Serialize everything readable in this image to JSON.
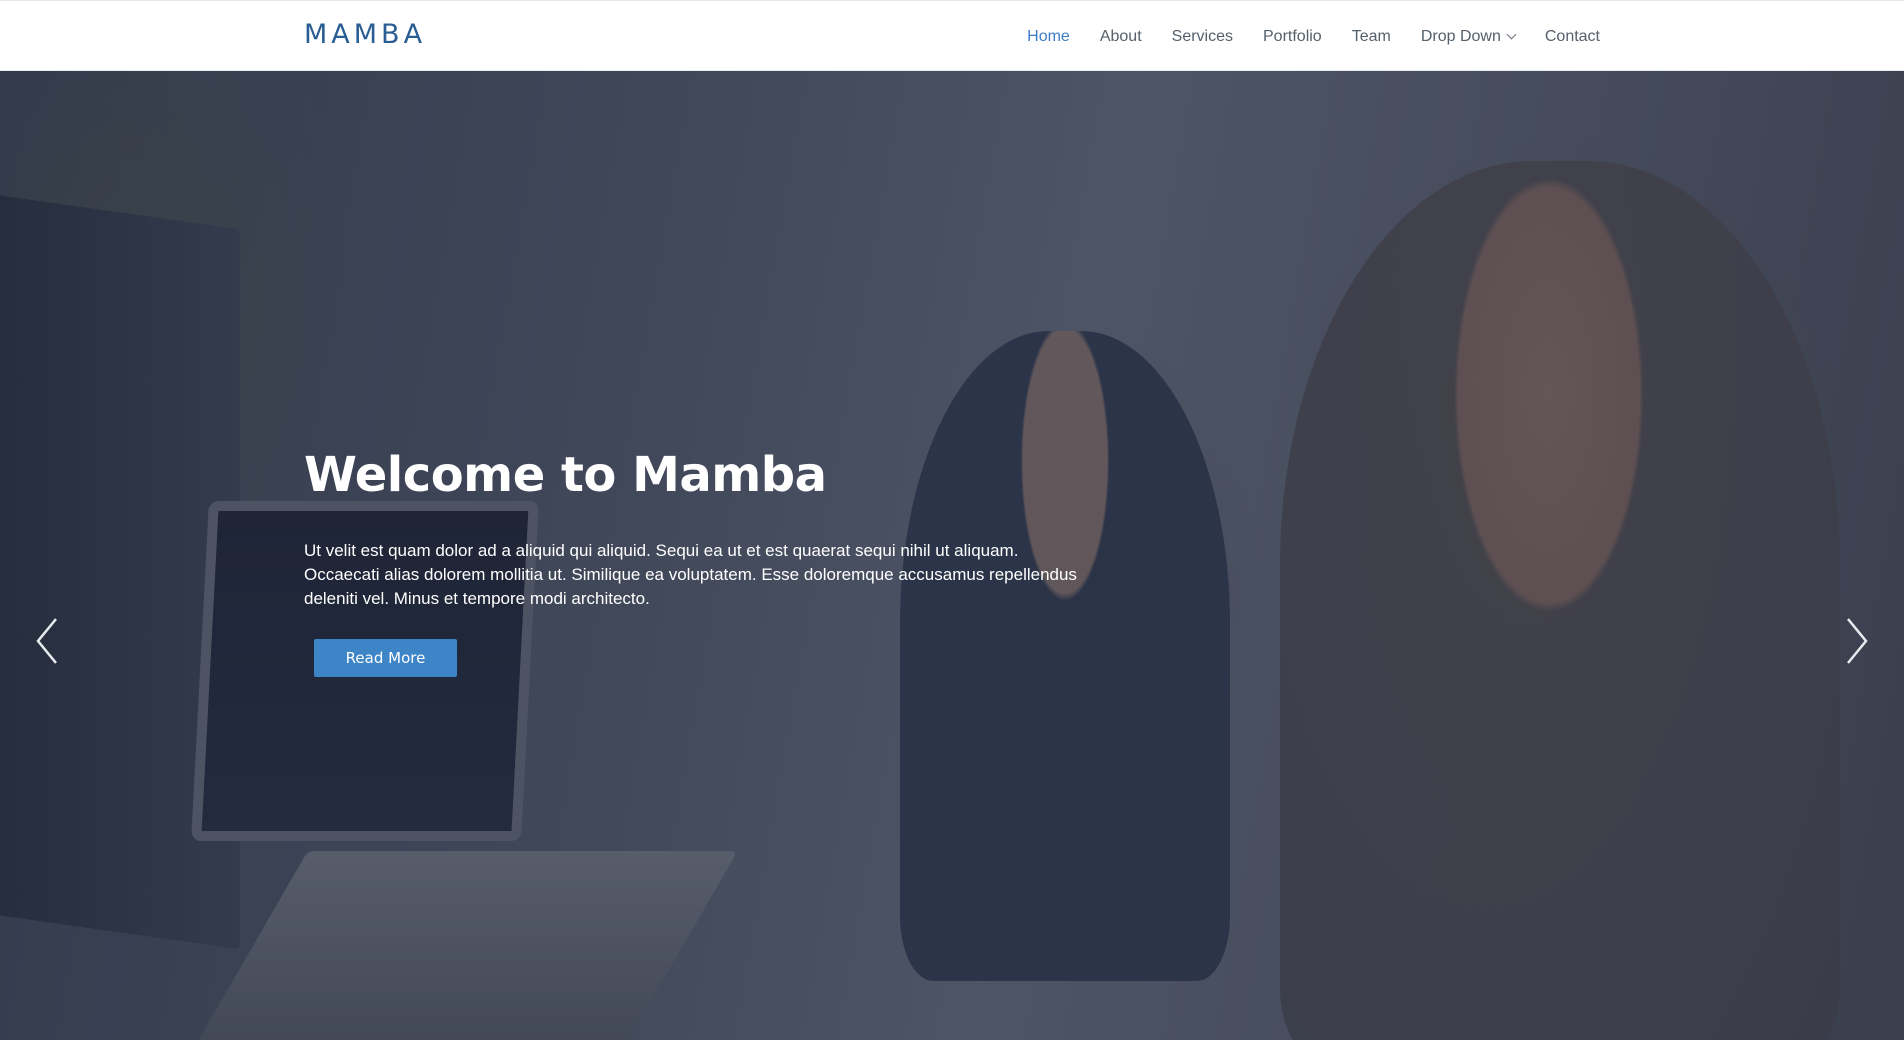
{
  "header": {
    "logo": "MAMBA",
    "nav": [
      {
        "label": "Home",
        "active": true
      },
      {
        "label": "About"
      },
      {
        "label": "Services"
      },
      {
        "label": "Portfolio"
      },
      {
        "label": "Team"
      },
      {
        "label": "Drop Down",
        "has_dropdown": true
      },
      {
        "label": "Contact"
      }
    ]
  },
  "hero": {
    "title": "Welcome to Mamba",
    "text_line1": "Ut velit est quam dolor ad a aliquid qui aliquid. Sequi ea ut et est quaerat sequi nihil ut aliquam.",
    "text_line2": "Occaecati alias dolorem mollitia ut. Similique ea voluptatem. Esse doloremque accusamus repellendus",
    "text_line3": "deleniti vel. Minus et tempore modi architecto.",
    "button_label": "Read More",
    "background_image": "photo of two men working at computers in an office",
    "slides_count": 3,
    "active_slide": 1
  },
  "icons": {
    "prev": "chevron-left-icon",
    "next": "chevron-right-icon",
    "dropdown": "chevron-down-icon"
  },
  "colors": {
    "brand": "#2a5d93",
    "nav_active": "#3d7dc6",
    "button": "#3d85c6",
    "overlay": "rgba(33,40,58,0.58)"
  }
}
